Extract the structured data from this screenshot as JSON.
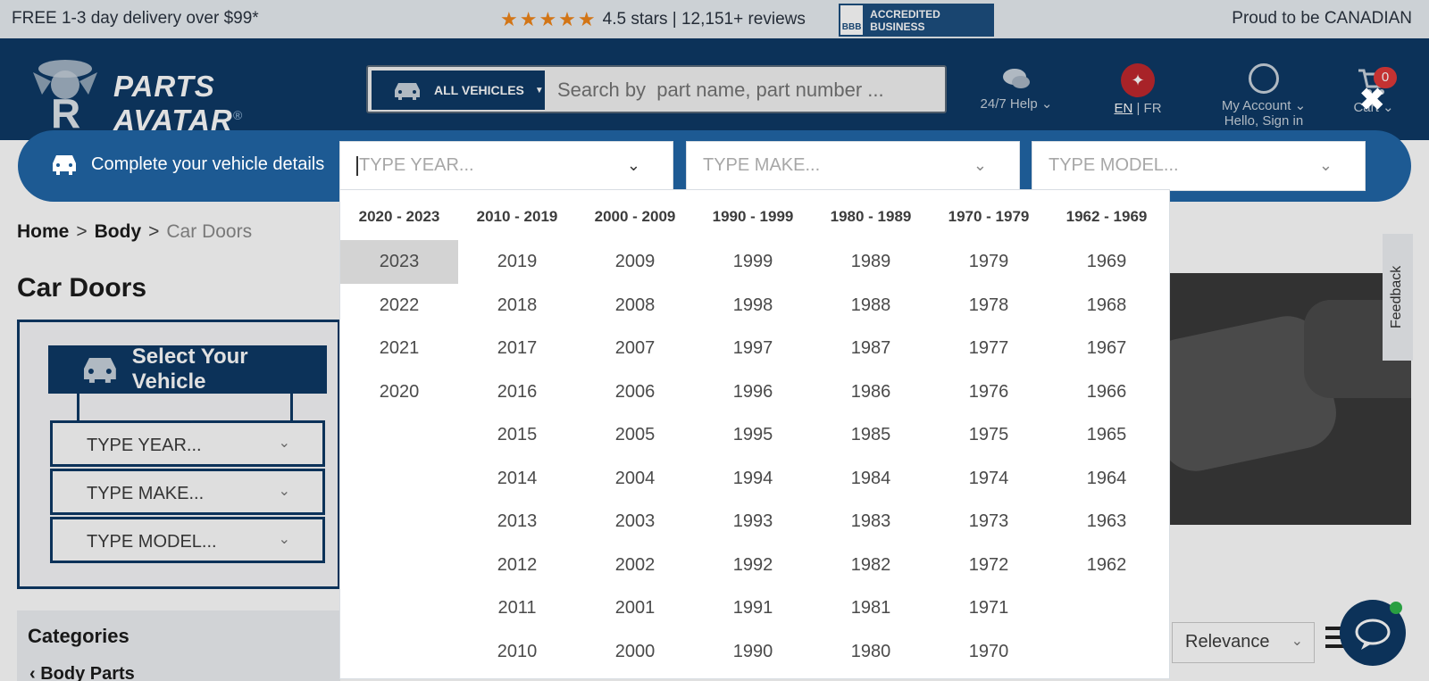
{
  "topbar": {
    "delivery": "FREE 1-3 day delivery over $99*",
    "rating_text": "4.5 stars | 12,151+ reviews",
    "stars": "★★★★★",
    "bbb_label": "ACCREDITED BUSINESS",
    "bbb_seal": "BBB",
    "canadian": "Proud to be CANADIAN"
  },
  "header": {
    "logo_line1": "PARTS",
    "logo_line2": "AVATAR",
    "logo_registered": "®",
    "vehicles_button": "ALL VEHICLES",
    "search_placeholder": "Search by  part name, part number ...",
    "help_label": "24/7 Help",
    "lang_en": "EN",
    "lang_sep": "|",
    "lang_fr": "FR",
    "account_label": "My Account",
    "account_sub": "Hello, Sign in",
    "cart_label": "Cart",
    "cart_count": "0"
  },
  "vehicle_bar": {
    "title": "Complete your vehicle details",
    "year_placeholder": "TYPE YEAR...",
    "make_placeholder": "TYPE MAKE...",
    "model_placeholder": "TYPE MODEL..."
  },
  "year_dropdown": {
    "selected": "2023",
    "columns": [
      {
        "header": "2020 - 2023",
        "years": [
          "2023",
          "2022",
          "2021",
          "2020"
        ]
      },
      {
        "header": "2010 - 2019",
        "years": [
          "2019",
          "2018",
          "2017",
          "2016",
          "2015",
          "2014",
          "2013",
          "2012",
          "2011",
          "2010"
        ]
      },
      {
        "header": "2000 - 2009",
        "years": [
          "2009",
          "2008",
          "2007",
          "2006",
          "2005",
          "2004",
          "2003",
          "2002",
          "2001",
          "2000"
        ]
      },
      {
        "header": "1990 - 1999",
        "years": [
          "1999",
          "1998",
          "1997",
          "1996",
          "1995",
          "1994",
          "1993",
          "1992",
          "1991",
          "1990"
        ]
      },
      {
        "header": "1980 - 1989",
        "years": [
          "1989",
          "1988",
          "1987",
          "1986",
          "1985",
          "1984",
          "1983",
          "1982",
          "1981",
          "1980"
        ]
      },
      {
        "header": "1970 - 1979",
        "years": [
          "1979",
          "1978",
          "1977",
          "1976",
          "1975",
          "1974",
          "1973",
          "1972",
          "1971",
          "1970"
        ]
      },
      {
        "header": "1962 - 1969",
        "years": [
          "1969",
          "1968",
          "1967",
          "1966",
          "1965",
          "1964",
          "1963",
          "1962"
        ]
      }
    ]
  },
  "breadcrumb": {
    "home": "Home",
    "sep": ">",
    "body": "Body",
    "current": "Car Doors"
  },
  "page": {
    "title": "Car Doors"
  },
  "sidebar_vehicle": {
    "title": "Select Your Vehicle",
    "year": "TYPE YEAR...",
    "make": "TYPE MAKE...",
    "model": "TYPE MODEL..."
  },
  "categories": {
    "title": "Categories",
    "first_item": "Body Parts"
  },
  "feedback": "Feedback",
  "sort": {
    "selected": "Relevance"
  },
  "colors": {
    "brand_navy": "#0e3a66",
    "bar_blue": "#1d5a93",
    "star_orange": "#f0861a",
    "selected_gray": "#d3d3d3"
  }
}
